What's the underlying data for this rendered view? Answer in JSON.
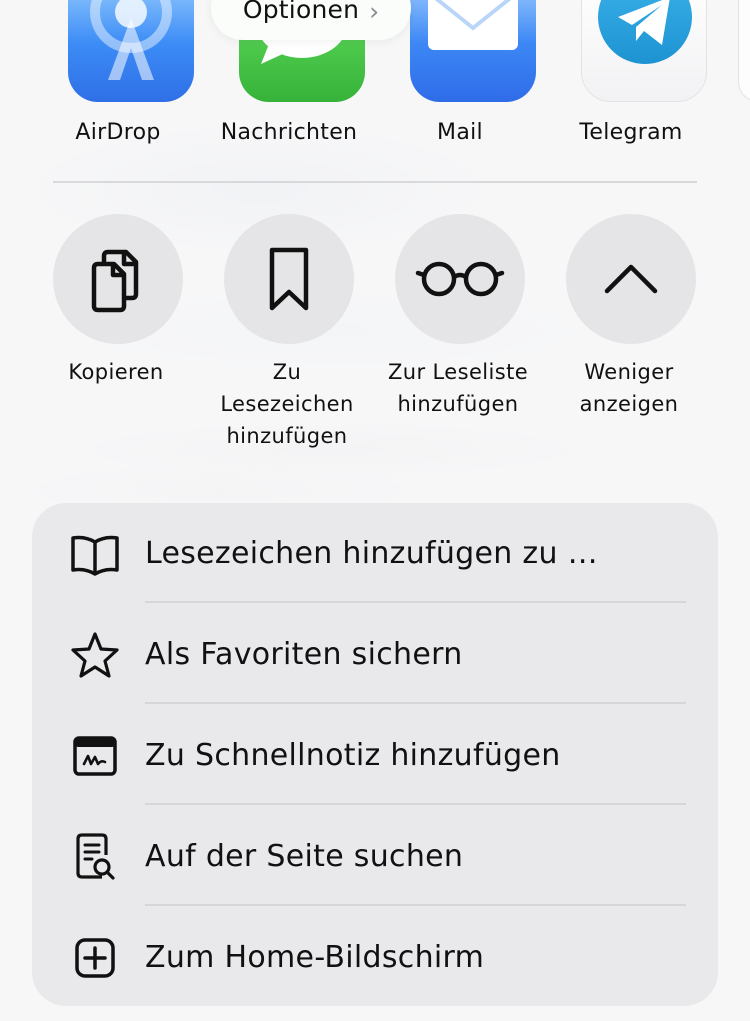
{
  "options": {
    "label": "Optionen",
    "chevron": "›"
  },
  "apps": [
    {
      "label": "AirDrop",
      "icon": "airdrop-icon"
    },
    {
      "label": "Nachrichten",
      "icon": "messages-icon"
    },
    {
      "label": "Mail",
      "icon": "mail-icon"
    },
    {
      "label": "Telegram",
      "icon": "telegram-icon"
    }
  ],
  "actions": [
    {
      "label": "Kopieren",
      "icon": "copy-icon"
    },
    {
      "label": "Zu\nLesezeichen\nhinzufügen",
      "icon": "bookmark-icon"
    },
    {
      "label": "Zur Leseliste\nhinzufügen",
      "icon": "glasses-icon"
    },
    {
      "label": "Weniger\nanzeigen",
      "icon": "chevron-up-icon"
    }
  ],
  "menu": [
    {
      "label": "Lesezeichen hinzufügen zu …",
      "icon": "book-icon"
    },
    {
      "label": "Als Favoriten sichern",
      "icon": "star-icon"
    },
    {
      "label": "Zu Schnellnotiz hinzufügen",
      "icon": "quick-note-icon"
    },
    {
      "label": "Auf der Seite suchen",
      "icon": "find-on-page-icon"
    },
    {
      "label": "Zum Home-Bildschirm",
      "icon": "add-square-icon"
    }
  ],
  "colors": {
    "action_circle": "#e5e5e7",
    "card": "#e9e9eb",
    "airdrop_blue": "#3c8cf6",
    "messages_green": "#4bc84a",
    "telegram_blue": "#2aa5e0"
  }
}
